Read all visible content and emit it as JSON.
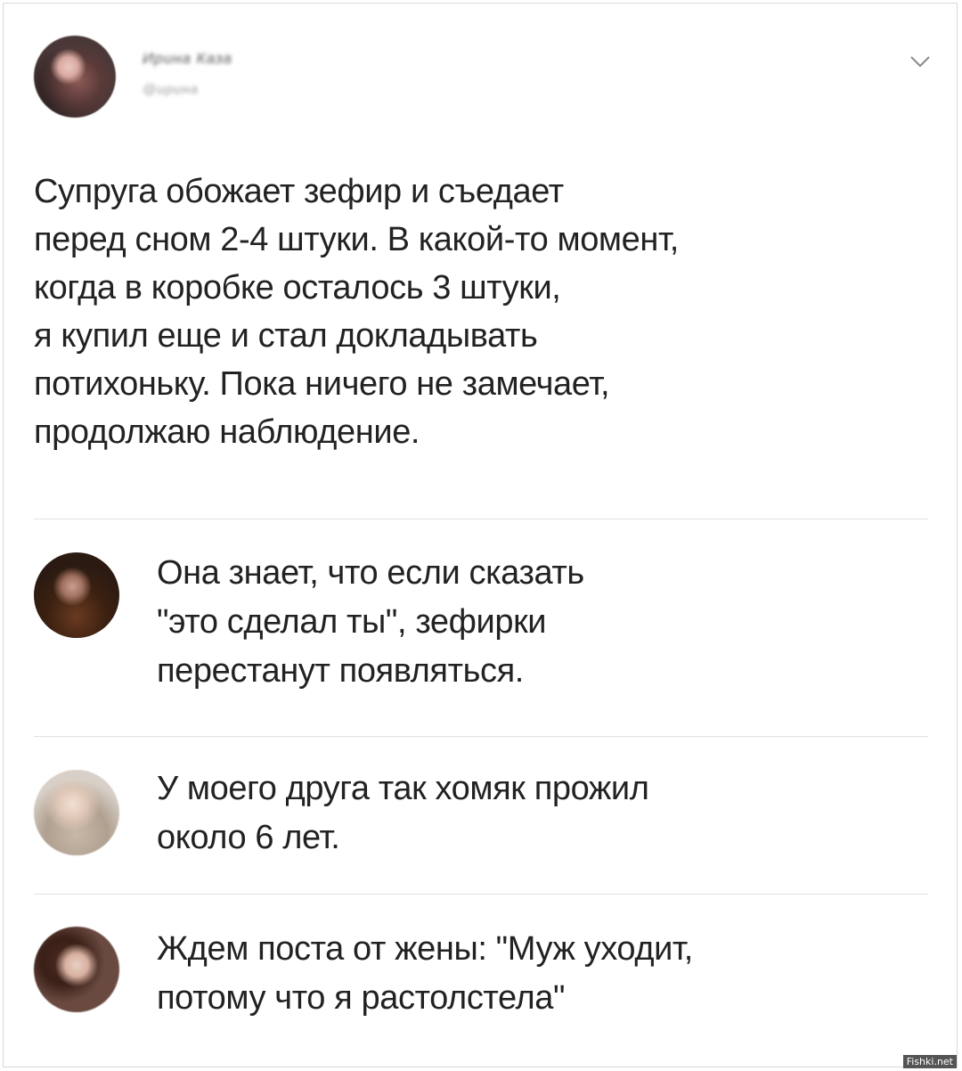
{
  "post": {
    "author_name": "Ирина Каза",
    "author_handle": "@ирина",
    "text_lines": [
      "Супруга обожает зефир и съедает",
      "перед сном 2-4 штуки. В какой-то момент,",
      "когда в коробке осталось 3 штуки,",
      "я купил еще и стал докладывать",
      "потихоньку. Пока ничего не замечает,",
      "продолжаю наблюдение."
    ],
    "icon": "chevron-down-icon"
  },
  "replies": [
    {
      "lines": [
        "Она знает, что если сказать",
        "\"это сделал ты\", зефирки",
        "перестанут появляться."
      ]
    },
    {
      "lines": [
        "У моего друга так хомяк прожил",
        "около 6 лет."
      ]
    },
    {
      "lines": [
        "Ждем поста от жены: \"Муж уходит,",
        "потому что я растолстела\""
      ]
    }
  ],
  "watermark": "Fishki.net"
}
